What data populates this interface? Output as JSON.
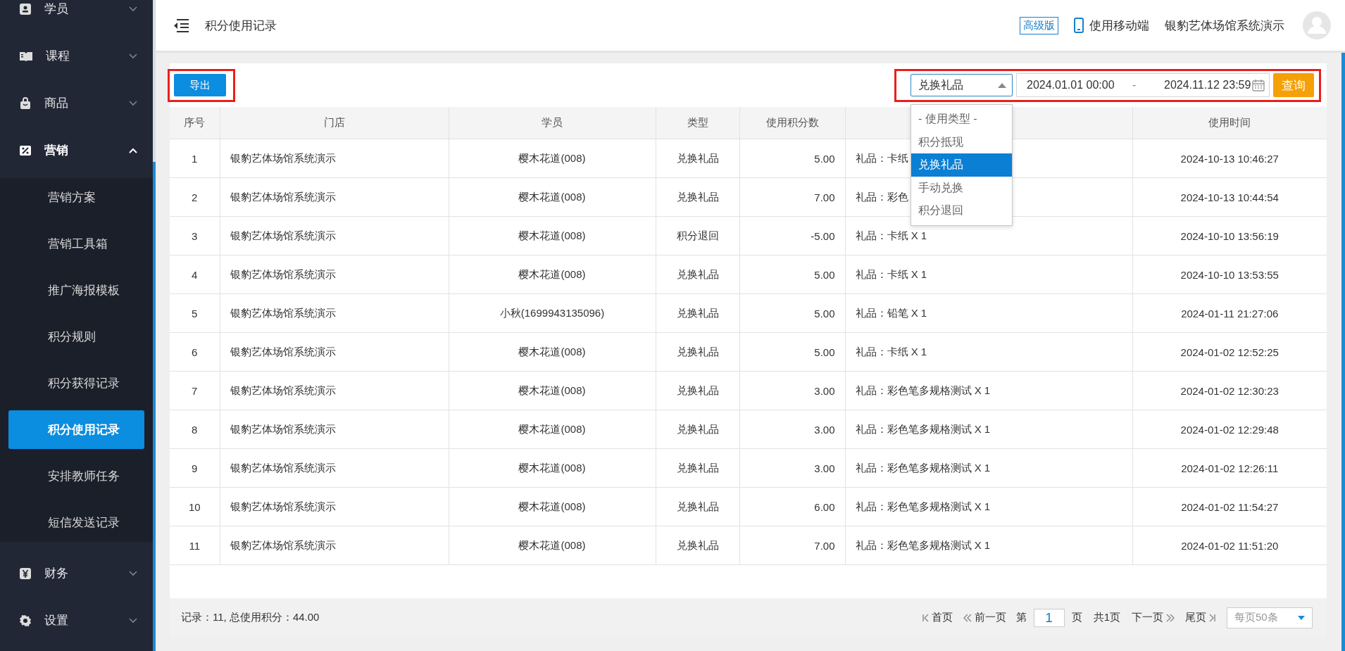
{
  "sidebar": {
    "items": [
      {
        "label": "学员",
        "expanded": false
      },
      {
        "label": "课程",
        "expanded": false
      },
      {
        "label": "商品",
        "expanded": false
      },
      {
        "label": "营销",
        "expanded": true,
        "children": [
          {
            "label": "营销方案",
            "selected": false
          },
          {
            "label": "营销工具箱",
            "selected": false
          },
          {
            "label": "推广海报模板",
            "selected": false
          },
          {
            "label": "积分规则",
            "selected": false
          },
          {
            "label": "积分获得记录",
            "selected": false
          },
          {
            "label": "积分使用记录",
            "selected": true
          },
          {
            "label": "安排教师任务",
            "selected": false
          },
          {
            "label": "短信发送记录",
            "selected": false
          }
        ]
      },
      {
        "label": "财务",
        "expanded": false
      },
      {
        "label": "设置",
        "expanded": false
      }
    ]
  },
  "topbar": {
    "page_title": "积分使用记录",
    "edition_badge": "高级版",
    "mobile_link": "使用移动端",
    "account_name": "银豹艺体场馆系统演示"
  },
  "toolbar": {
    "export_button": "导出",
    "type_select": {
      "value": "兑换礼品",
      "expanded": true,
      "options": [
        {
          "label": "- 使用类型 -",
          "selected": false
        },
        {
          "label": "积分抵现",
          "selected": false
        },
        {
          "label": "兑换礼品",
          "selected": true
        },
        {
          "label": "手动兑换",
          "selected": false
        },
        {
          "label": "积分退回",
          "selected": false
        }
      ]
    },
    "date_range": {
      "start": "2024.01.01 00:00",
      "separator": "-",
      "end": "2024.11.12 23:59"
    },
    "query_button": "查询"
  },
  "table": {
    "columns": [
      "序号",
      "门店",
      "学员",
      "类型",
      "使用积分数",
      "",
      "使用时间"
    ],
    "rows": [
      [
        "1",
        "银豹艺体场馆系统演示",
        "樱木花道(008)",
        "兑换礼品",
        "5.00",
        "礼品：卡纸",
        "2024-10-13 10:46:27"
      ],
      [
        "2",
        "银豹艺体场馆系统演示",
        "樱木花道(008)",
        "兑换礼品",
        "7.00",
        "礼品：彩色",
        "2024-10-13 10:44:54"
      ],
      [
        "3",
        "银豹艺体场馆系统演示",
        "樱木花道(008)",
        "积分退回",
        "-5.00",
        "礼品：卡纸 X 1",
        "2024-10-10 13:56:19"
      ],
      [
        "4",
        "银豹艺体场馆系统演示",
        "樱木花道(008)",
        "兑换礼品",
        "5.00",
        "礼品：卡纸 X 1",
        "2024-10-10 13:53:55"
      ],
      [
        "5",
        "银豹艺体场馆系统演示",
        "小秋(1699943135096)",
        "兑换礼品",
        "5.00",
        "礼品：铅笔 X 1",
        "2024-01-11 21:27:06"
      ],
      [
        "6",
        "银豹艺体场馆系统演示",
        "樱木花道(008)",
        "兑换礼品",
        "5.00",
        "礼品：卡纸 X 1",
        "2024-01-02 12:52:25"
      ],
      [
        "7",
        "银豹艺体场馆系统演示",
        "樱木花道(008)",
        "兑换礼品",
        "3.00",
        "礼品：彩色笔多规格测试 X 1",
        "2024-01-02 12:30:23"
      ],
      [
        "8",
        "银豹艺体场馆系统演示",
        "樱木花道(008)",
        "兑换礼品",
        "3.00",
        "礼品：彩色笔多规格测试 X 1",
        "2024-01-02 12:29:48"
      ],
      [
        "9",
        "银豹艺体场馆系统演示",
        "樱木花道(008)",
        "兑换礼品",
        "3.00",
        "礼品：彩色笔多规格测试 X 1",
        "2024-01-02 12:26:11"
      ],
      [
        "10",
        "银豹艺体场馆系统演示",
        "樱木花道(008)",
        "兑换礼品",
        "6.00",
        "礼品：彩色笔多规格测试 X 1",
        "2024-01-02 11:54:27"
      ],
      [
        "11",
        "银豹艺体场馆系统演示",
        "樱木花道(008)",
        "兑换礼品",
        "7.00",
        "礼品：彩色笔多规格测试 X 1",
        "2024-01-02 11:51:20"
      ]
    ]
  },
  "footer": {
    "summary": "记录：11, 总使用积分：44.00",
    "pagination": {
      "first": "首页",
      "prev": "前一页",
      "page_prefix": "第",
      "page_input": "1",
      "page_suffix": "页",
      "total": "共1页",
      "next": "下一页",
      "last": "尾页",
      "page_size": "每页50条"
    }
  }
}
